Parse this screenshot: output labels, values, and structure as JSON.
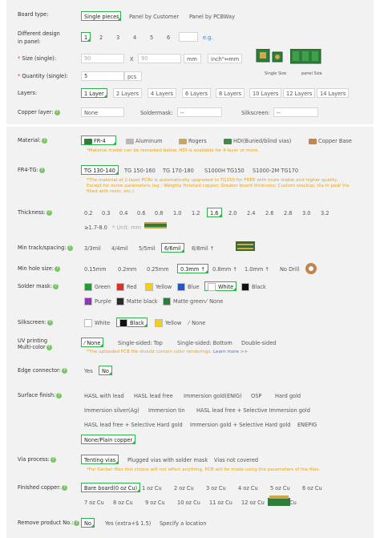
{
  "board_type": {
    "label": "Board type:",
    "options": [
      "Single pieces",
      "Panel by Customer",
      "Panel by PCBWay"
    ],
    "selected": 0
  },
  "panel_design": {
    "label_1": "Different design",
    "label_2": "in panel:",
    "options": [
      "1",
      "2",
      "3",
      "4",
      "5",
      "6"
    ],
    "selected": 0,
    "eg": "e.g."
  },
  "size": {
    "label": "Size (single):",
    "width": "90",
    "x": "X",
    "height": "90",
    "unit": "mm",
    "toggle": "inch\"↔mm",
    "caption_single": "Single Size",
    "caption_panel": "panel Size"
  },
  "quantity": {
    "label": "Quantity (single):",
    "value": "5",
    "unit": "pcs"
  },
  "layers": {
    "label": "Layers:",
    "options": [
      "1 Layer",
      "2 Layers",
      "4 Layers",
      "6 Layers",
      "8 Layers",
      "10 Layers",
      "12 Layers",
      "14 Layers"
    ],
    "selected": 0
  },
  "copper_layer": {
    "label": "Copper layer:",
    "value": "None",
    "soldermask_label": "Soldermask:",
    "soldermask_value": "--",
    "silkscreen_label": "Silkscreen:",
    "silkscreen_value": "--"
  },
  "material": {
    "label": "Material:",
    "options": [
      "FR-4",
      "Aluminum",
      "Rogers",
      "HDI(Buried/blind vias)",
      "Copper Base"
    ],
    "selected": 0,
    "note": "*Material model can be remarked below. HDI is available for 4-layer or more."
  },
  "fr4_tg": {
    "label": "FR4-TG:",
    "options": [
      "TG 130-140",
      "TG 150-160",
      "TG 170-180",
      "S1000H TG150",
      "S1000-2M TG170"
    ],
    "selected": 0,
    "note_1": "*The material of 2-layer PCBs is automatically upgraded to TG150 for FREE with more stable and higher quality.",
    "note_2": "Except for some parameters (eg : Weighty finished copper; Greater board thickness; Custom stackup; Via in pad/ Via",
    "note_3": "filled with resin, etc.)"
  },
  "thickness": {
    "label": "Thickness:",
    "options": [
      "0.2",
      "0.3",
      "0.4",
      "0.6",
      "0.8",
      "1.0",
      "1.2",
      "1.6",
      "2.0",
      "2.4",
      "2.6",
      "2.8",
      "3.0",
      "3.2"
    ],
    "selected": 7,
    "extra": "≥1.7-8.0",
    "unit": "* Unit: mm"
  },
  "track": {
    "label": "Min track/spacing:",
    "options": [
      "3/3mil",
      "4/4mil",
      "5/5mil",
      "6/6mil",
      "8/8mil ↑"
    ],
    "selected": 3
  },
  "hole": {
    "label": "Min hole size:",
    "options": [
      "0.15mm",
      "0.2mm",
      "0.25mm",
      "0.3mm ↑",
      "0.8mm ↑",
      "1.0mm ↑",
      "No Drill"
    ],
    "selected": 3
  },
  "soldermask": {
    "label": "Solder mask:",
    "options": [
      {
        "name": "Green",
        "color": "#1f9c34"
      },
      {
        "name": "Red",
        "color": "#d93030"
      },
      {
        "name": "Yellow",
        "color": "#f3cf1b"
      },
      {
        "name": "Blue",
        "color": "#2b53c9"
      },
      {
        "name": "White",
        "color": "#ffffff"
      },
      {
        "name": "Black",
        "color": "#111111"
      },
      {
        "name": "Purple",
        "color": "#8c3bb5"
      },
      {
        "name": "Matte black",
        "color": "#2b2b2b"
      },
      {
        "name": "Matte green",
        "color": "#2f7d3a"
      },
      {
        "name": "None",
        "color": "none"
      }
    ],
    "selected": 4
  },
  "silkscreen": {
    "label": "Silkscreen:",
    "options": [
      {
        "name": "White",
        "color": "#ffffff"
      },
      {
        "name": "Black",
        "color": "#111111"
      },
      {
        "name": "Yellow",
        "color": "#f3cf1b"
      },
      {
        "name": "None",
        "color": "none"
      }
    ],
    "selected": 1
  },
  "uv": {
    "label_1": "UV printing",
    "label_2": "Multi-color",
    "options": [
      "None",
      "Single-sided: Top",
      "Single-sided: Bottom",
      "Double-sided"
    ],
    "selected": 0,
    "note": "*The uploaded PCB file should contain color renderings.",
    "link": "Learn more >>"
  },
  "edge": {
    "label": "Edge connector:",
    "options": [
      "Yes",
      "No"
    ],
    "selected": 1
  },
  "surface": {
    "label": "Surface finish:",
    "options": [
      "HASL with lead",
      "HASL lead free",
      "Immersion gold(ENIG)",
      "OSP",
      "Hard gold",
      "Immersion silver(Ag)",
      "Immersion tin",
      "HASL lead free + Selective Immersion gold",
      "HASL lead free + Selective Hard gold",
      "Immersion gold + Selective Hard gold",
      "ENEPIG",
      "None/Plain copper"
    ],
    "selected": 11
  },
  "via": {
    "label": "Via process:",
    "options": [
      "Tenting vias",
      "Plugged vias with solder mask",
      "Vias not covered"
    ],
    "selected": 0,
    "note": "*For Gerber files this choice will not affect anything, PCB will be made using the parameters of the files."
  },
  "copper": {
    "label": "Finished copper:",
    "options": [
      "Bare board(0 oz Cu)",
      "1 oz Cu",
      "2 oz Cu",
      "3 oz Cu",
      "4 oz Cu",
      "5 oz Cu",
      "6 oz Cu",
      "7 oz Cu",
      "8 oz Cu",
      "9 oz Cu",
      "10 oz Cu",
      "11 oz Cu",
      "12 oz Cu",
      "13 oz Cu"
    ],
    "selected": 0
  },
  "remove": {
    "label": "Remove product No.:",
    "options": [
      "No",
      "Yes (extra+$ 1.5)",
      "Specify a location"
    ],
    "selected": 0
  }
}
